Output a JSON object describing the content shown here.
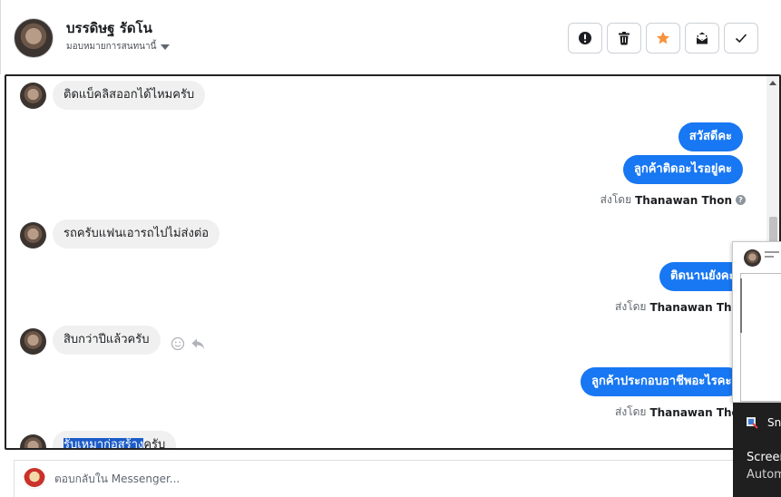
{
  "header": {
    "contact_name": "บรรดิษฐ รัดโน",
    "assign_label": "มอบหมายการสนทนานี้",
    "actions": [
      {
        "icon": "alert-icon",
        "color": "#1c1e21"
      },
      {
        "icon": "trash-icon",
        "color": "#1c1e21"
      },
      {
        "icon": "star-icon",
        "color": "#f7923b"
      },
      {
        "icon": "mark-unread-icon",
        "color": "#1c1e21"
      },
      {
        "icon": "check-icon",
        "color": "#1c1e21"
      }
    ]
  },
  "messages": [
    {
      "side": "in",
      "text": "ติดแบ็คลิสออกได้ไหมครับ"
    },
    {
      "side": "out",
      "text": "สวัสดีคะ"
    },
    {
      "side": "out",
      "text": "ลูกค้าติดอะไรอยู่คะ"
    },
    {
      "side": "in",
      "text": "รถครับแฟนเอารถไปไม่ส่งต่อ"
    },
    {
      "side": "out",
      "text": "ติดนานยังคะ"
    },
    {
      "side": "in",
      "text": "สิบกว่าปีแล้วครับ"
    },
    {
      "side": "out",
      "text": "ลูกค้าประกอบอาชีพอะไรคะ"
    },
    {
      "side": "in",
      "text_highlighted": "รับเหมาก่อสร้าง",
      "text_rest": "ครับ"
    }
  ],
  "sent_by": {
    "prefix": "ส่งโดย",
    "name": "Thanawan Thon",
    "help_icon": "?"
  },
  "reply": {
    "placeholder": "ตอบกลับใน Messenger..."
  },
  "toast": {
    "app": "Sn",
    "title": "Screen",
    "subtitle": "Autom"
  },
  "colors": {
    "outgoing_bubble": "#1877f2",
    "incoming_bubble": "#f0f0f0",
    "star": "#f7923b",
    "highlight": "#1c5cc8"
  }
}
